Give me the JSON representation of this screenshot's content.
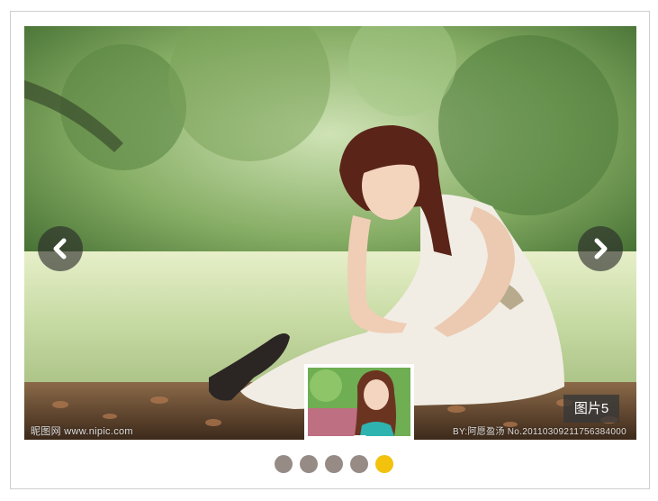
{
  "slider": {
    "caption": "图片5",
    "watermark_left": "昵图网 www.nipic.com",
    "watermark_right": "BY:阿愿盈汤 No.20110309211756384000",
    "prev_icon": "chevron-left-icon",
    "next_icon": "chevron-right-icon",
    "total_slides": 5,
    "active_index": 5,
    "dots": [
      {
        "state": "inactive"
      },
      {
        "state": "inactive"
      },
      {
        "state": "inactive"
      },
      {
        "state": "inactive"
      },
      {
        "state": "active"
      }
    ]
  },
  "colors": {
    "dot_inactive": "#968b85",
    "dot_active": "#f2c20d",
    "nav_button_bg": "#282828",
    "caption_bg": "#373737",
    "frame_border": "#cfcfcf"
  }
}
